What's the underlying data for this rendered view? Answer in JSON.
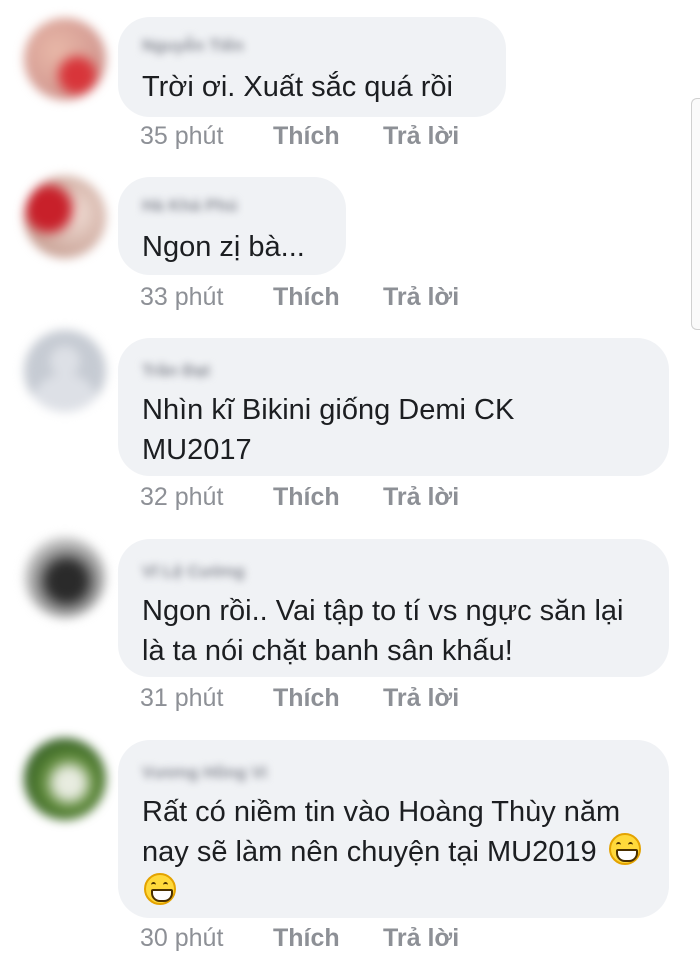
{
  "comments": [
    {
      "author": "Nguyễn Tiến",
      "text": "Trời ơi.  Xuất sắc quá rồi",
      "time": "35 phút",
      "like": "Thích",
      "reply": "Trả lời"
    },
    {
      "author": "Hà Khả Phú",
      "text": "Ngon zị bà...",
      "time": "33 phút",
      "like": "Thích",
      "reply": "Trả lời"
    },
    {
      "author": "Trần Đạt",
      "text": "Nhìn kĩ Bikini giống Demi CK MU2017",
      "time": "32 phút",
      "like": "Thích",
      "reply": "Trả lời"
    },
    {
      "author": "Vĩ Lệ Cường",
      "text": "Ngon rồi.. Vai tập to tí vs ngực săn lại là ta nói chặt banh sân khấu!",
      "time": "31 phút",
      "like": "Thích",
      "reply": "Trả lời"
    },
    {
      "author": "Vương Hồng Vi",
      "text": "Rất có niềm tin vào Hoàng Thùy năm nay sẽ làm nên chuyện tại MU2019",
      "time": "30 phút",
      "like": "Thích",
      "reply": "Trả lời",
      "emojis": [
        "grinning-face-emoji",
        "grinning-face-emoji"
      ]
    }
  ]
}
